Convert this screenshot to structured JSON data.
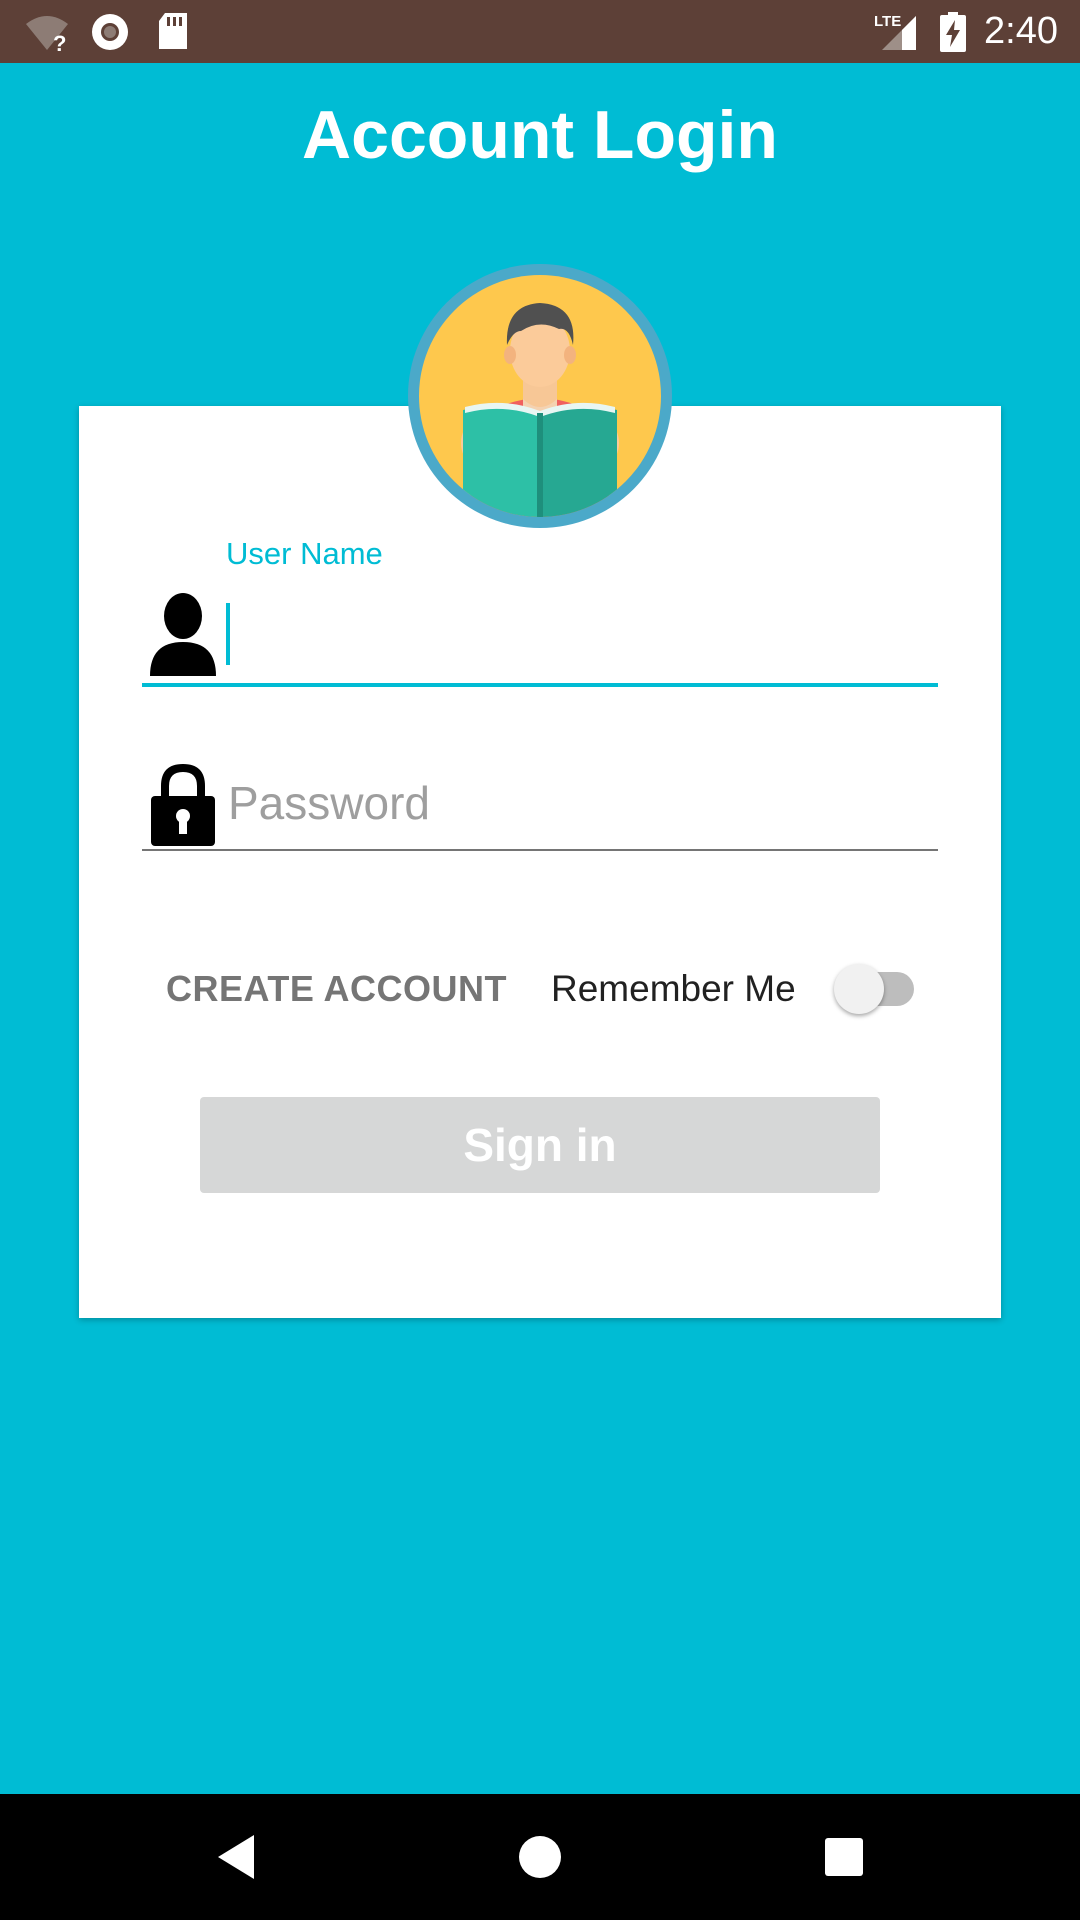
{
  "status_bar": {
    "time": "2:40",
    "network_label": "LTE",
    "icons": [
      "wifi-unknown-icon",
      "record-icon",
      "sd-card-icon",
      "signal-icon",
      "battery-charging-icon"
    ]
  },
  "title": "Account Login",
  "avatar": {
    "icon": "reader-avatar-icon"
  },
  "username": {
    "label": "User Name",
    "value": "",
    "icon": "user-icon",
    "focused": true
  },
  "password": {
    "placeholder": "Password",
    "value": "",
    "icon": "lock-icon"
  },
  "actions": {
    "create_account": "CREATE ACCOUNT",
    "remember_me": "Remember Me",
    "remember_me_on": false,
    "sign_in": "Sign in"
  },
  "nav_bar": {
    "icons": [
      "back-icon",
      "home-icon",
      "recents-icon"
    ]
  },
  "colors": {
    "primary": "#00BCD4",
    "status_bar": "#5D4037",
    "card": "#FFFFFF",
    "button_disabled": "#D6D7D7",
    "avatar_bg": "#FEC84D",
    "avatar_ring": "#4BA9C9"
  }
}
